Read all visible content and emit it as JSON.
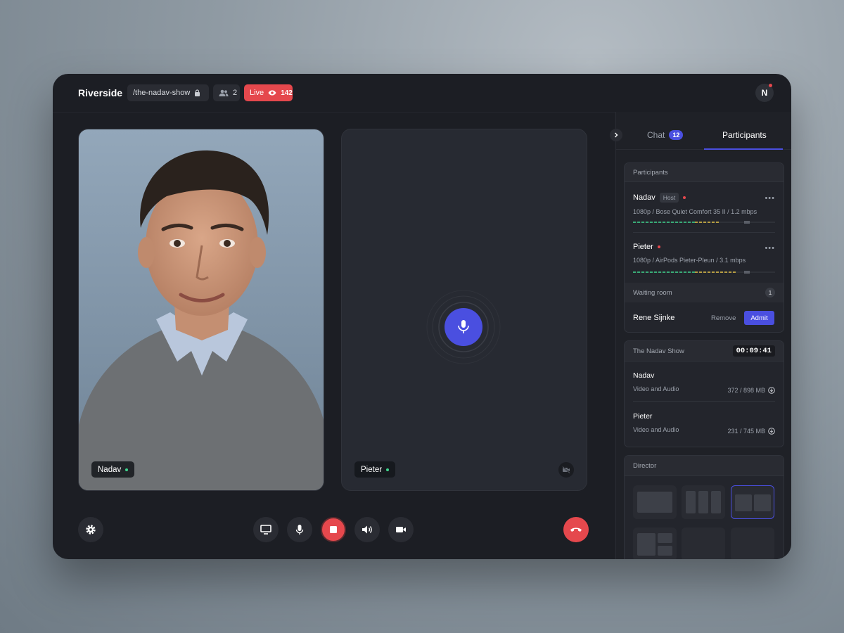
{
  "app": {
    "brand": "Riverside",
    "slug": "/the-nadav-show",
    "participant_count": "2",
    "live_label": "Live",
    "viewer_count": "142",
    "user_initial": "N"
  },
  "stage": {
    "tiles": [
      {
        "name": "Nadav",
        "status": "online"
      },
      {
        "name": "Pieter",
        "status": "online",
        "camera": "off"
      }
    ]
  },
  "controls": {
    "icons": [
      "settings-icon",
      "screen-share-icon",
      "microphone-icon",
      "record-stop-icon",
      "speaker-icon",
      "camera-icon",
      "end-call-icon"
    ]
  },
  "panel": {
    "tabs": {
      "chat_label": "Chat",
      "chat_badge": "12",
      "participants_label": "Participants"
    },
    "participants_card": {
      "title": "Participants",
      "people": [
        {
          "name": "Nadav",
          "badge": "Host",
          "spec": "1080p / Bose Quiet Comfort 35 II / 1.2 mbps"
        },
        {
          "name": "Pieter",
          "spec": "1080p / AirPods Pieter-Pleun / 3.1 mbps"
        }
      ],
      "waiting_room_label": "Waiting room",
      "waiting_count": "1",
      "waiting_name": "Rene Sijnke",
      "remove_label": "Remove",
      "admit_label": "Admit"
    },
    "recording_card": {
      "title": "The Nadav Show",
      "timer": "00:09:41",
      "tracks": [
        {
          "name": "Nadav",
          "type": "Video and Audio",
          "size": "372 / 898 MB"
        },
        {
          "name": "Pieter",
          "type": "Video and Audio",
          "size": "231 / 745 MB"
        }
      ]
    },
    "director_card": {
      "title": "Director",
      "selected_layout_index": 2
    }
  },
  "colors": {
    "accent": "#4a4fe0",
    "live_red": "#e5484d",
    "online_green": "#3fd68e",
    "background": "#1c1e24"
  }
}
